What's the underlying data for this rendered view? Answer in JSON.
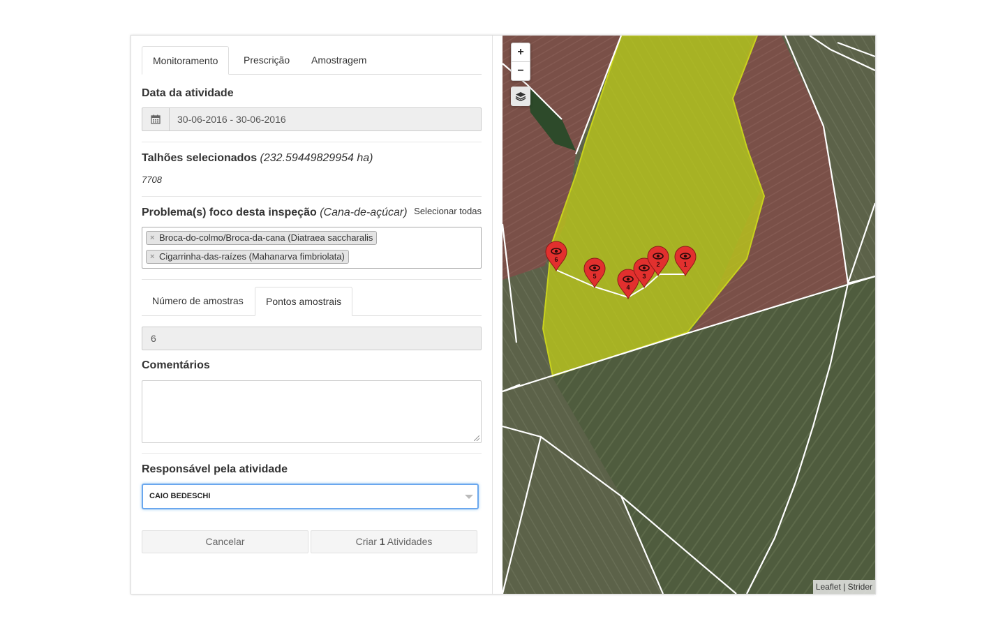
{
  "tabs": [
    "Monitoramento",
    "Prescrição",
    "Amostragem"
  ],
  "date_section": {
    "label": "Data da atividade",
    "value": "30-06-2016 - 30-06-2016",
    "icon": "calendar-icon"
  },
  "plots_section": {
    "label": "Talhões selecionados",
    "area": "(232.59449829954 ha)",
    "plot_id": "7708"
  },
  "problems_section": {
    "label": "Problema(s) foco desta inspeção",
    "crop": "(Cana-de-açúcar)",
    "select_all": "Selecionar todas",
    "tags": [
      "Broca-do-colmo/Broca-da-cana (Diatraea saccharalis",
      "Cigarrinha-das-raízes (Mahanarva fimbriolata)"
    ]
  },
  "sample_tabs": [
    "Número de amostras",
    "Pontos amostrais"
  ],
  "sample_count": "6",
  "comments_label": "Comentários",
  "responsible_section": {
    "label": "Responsável pela atividade",
    "value": "CAIO BEDESCHI"
  },
  "buttons": {
    "cancel": "Cancelar",
    "create_prefix": "Criar",
    "create_count": "1",
    "create_suffix": "Atividades"
  },
  "map": {
    "zoom_in": "+",
    "zoom_out": "−",
    "markers": [
      "6",
      "5",
      "4",
      "3",
      "2",
      "1"
    ],
    "attribution": [
      "Leaflet",
      "Strider"
    ],
    "colors": {
      "field_highlight": "#b8c41c",
      "marker": "#e2302e",
      "field_border": "#ffffff"
    }
  }
}
